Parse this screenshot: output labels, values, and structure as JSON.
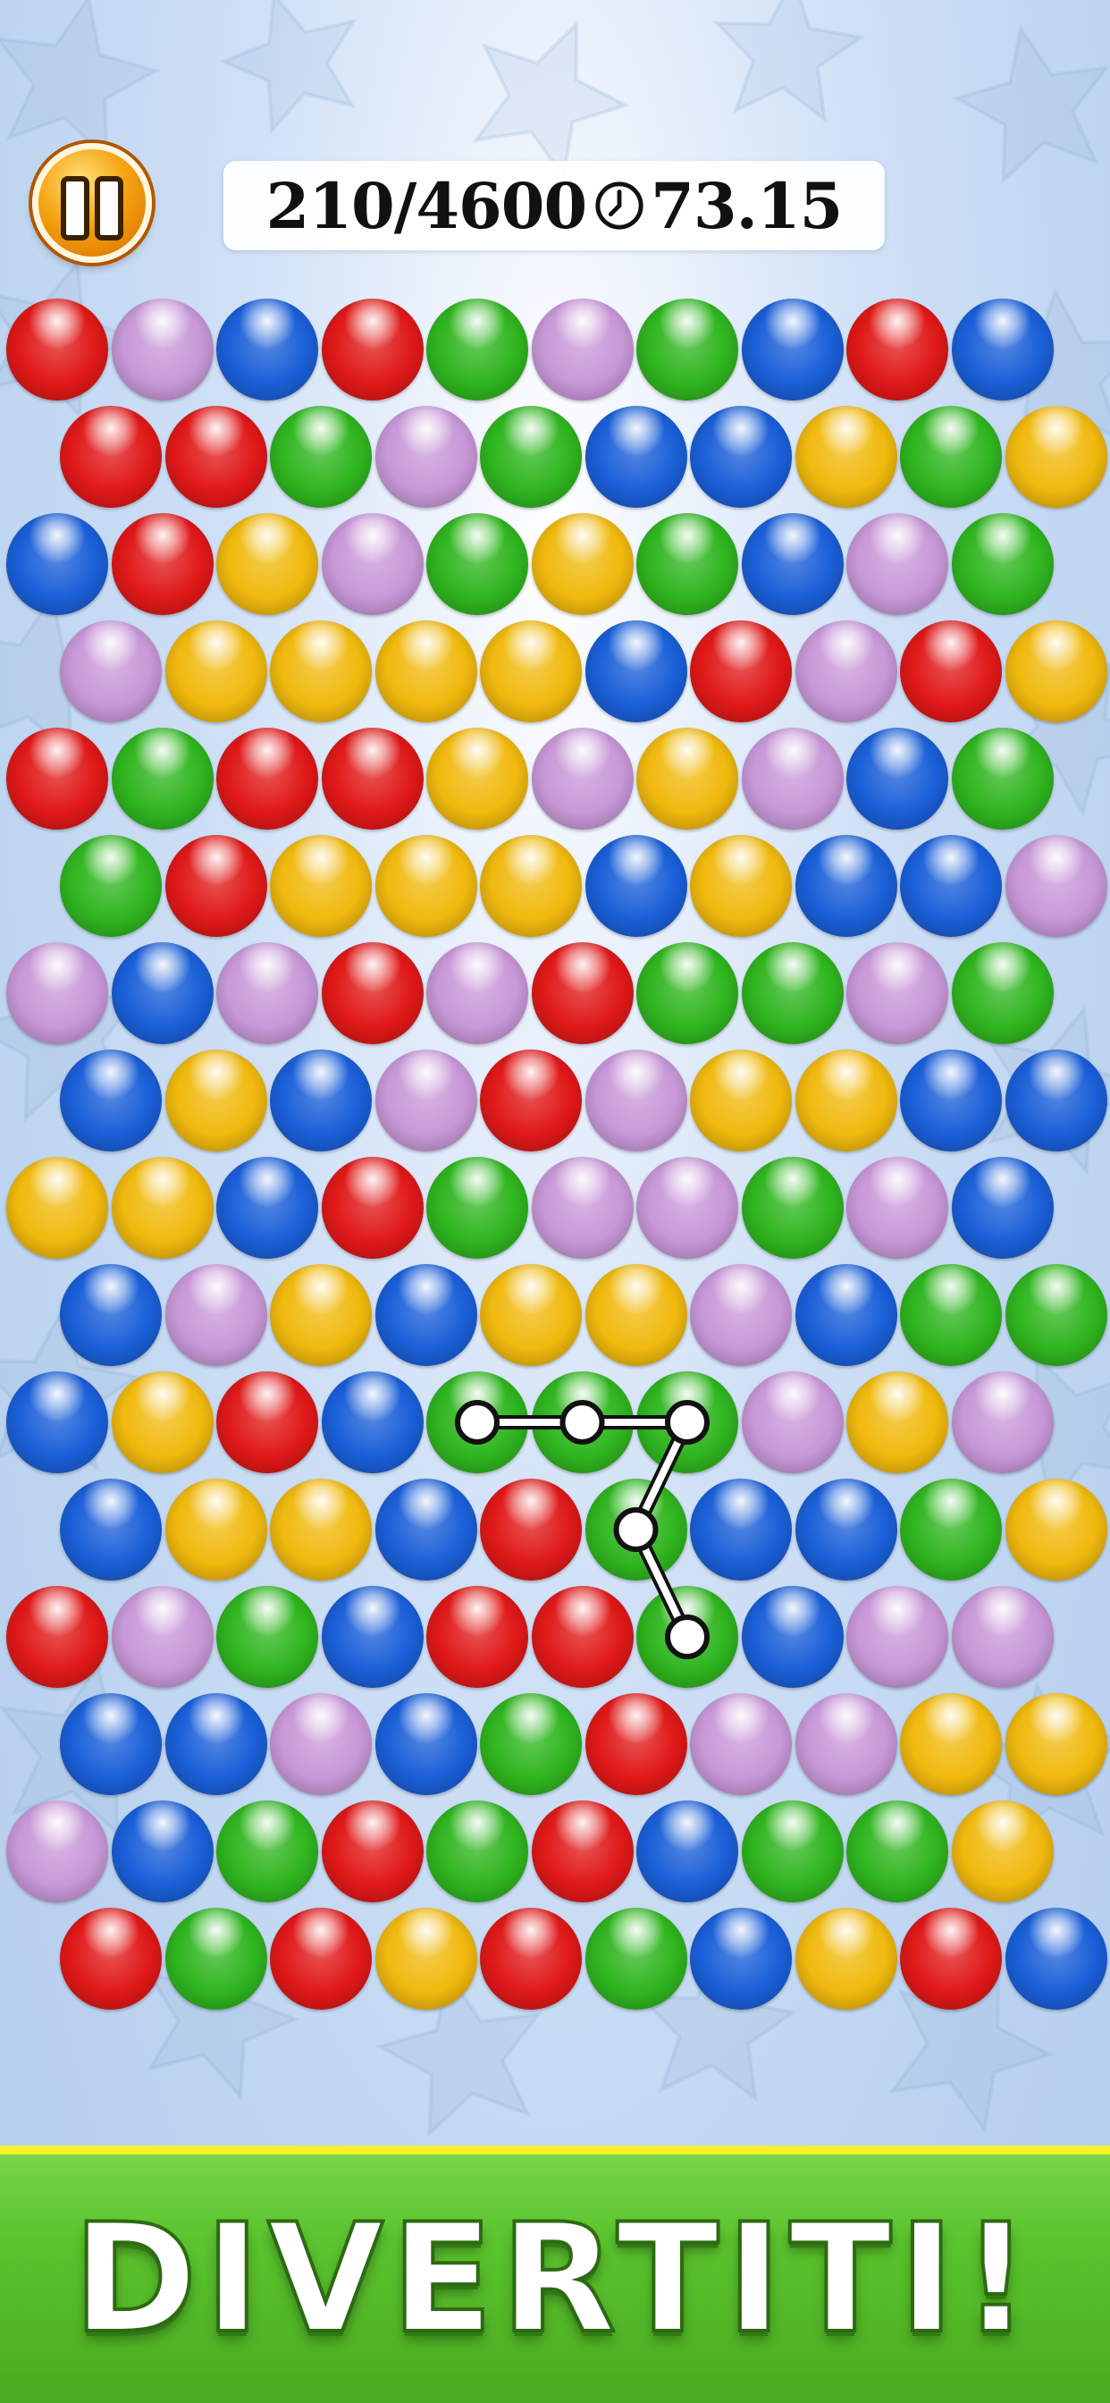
{
  "hud": {
    "score": "210/4600",
    "time": "73.15",
    "pause_icon": "pause-icon",
    "clock_icon": "clock-icon"
  },
  "board": {
    "rows": [
      [
        "red",
        "purple",
        "blue",
        "red",
        "green",
        "purple",
        "green",
        "blue",
        "red",
        "blue"
      ],
      [
        "red",
        "red",
        "green",
        "purple",
        "green",
        "blue",
        "blue",
        "yellow",
        "green",
        "yellow"
      ],
      [
        "blue",
        "red",
        "yellow",
        "purple",
        "green",
        "yellow",
        "green",
        "blue",
        "purple",
        "green"
      ],
      [
        "purple",
        "yellow",
        "yellow",
        "yellow",
        "yellow",
        "blue",
        "red",
        "purple",
        "red",
        "yellow"
      ],
      [
        "red",
        "green",
        "red",
        "red",
        "yellow",
        "purple",
        "yellow",
        "purple",
        "blue",
        "green"
      ],
      [
        "green",
        "red",
        "yellow",
        "yellow",
        "yellow",
        "blue",
        "yellow",
        "blue",
        "blue",
        "purple"
      ],
      [
        "purple",
        "blue",
        "purple",
        "red",
        "purple",
        "red",
        "green",
        "green",
        "purple",
        "green"
      ],
      [
        "blue",
        "yellow",
        "blue",
        "purple",
        "red",
        "purple",
        "yellow",
        "yellow",
        "blue",
        "blue"
      ],
      [
        "yellow",
        "yellow",
        "blue",
        "red",
        "green",
        "purple",
        "purple",
        "green",
        "purple",
        "blue"
      ],
      [
        "blue",
        "purple",
        "yellow",
        "blue",
        "yellow",
        "yellow",
        "purple",
        "blue",
        "green",
        "green"
      ],
      [
        "blue",
        "yellow",
        "red",
        "blue",
        "green",
        "green",
        "green",
        "purple",
        "yellow",
        "purple"
      ],
      [
        "blue",
        "yellow",
        "yellow",
        "blue",
        "red",
        "green",
        "blue",
        "blue",
        "green",
        "yellow"
      ],
      [
        "red",
        "purple",
        "green",
        "blue",
        "red",
        "red",
        "green",
        "blue",
        "purple",
        "purple"
      ],
      [
        "blue",
        "blue",
        "purple",
        "blue",
        "green",
        "red",
        "purple",
        "purple",
        "yellow",
        "yellow"
      ],
      [
        "purple",
        "blue",
        "green",
        "red",
        "green",
        "red",
        "blue",
        "green",
        "green",
        "yellow"
      ],
      [
        "red",
        "green",
        "red",
        "yellow",
        "red",
        "green",
        "blue",
        "yellow",
        "red",
        "blue"
      ]
    ],
    "selected_path": [
      [
        10,
        4
      ],
      [
        10,
        5
      ],
      [
        10,
        6
      ],
      [
        11,
        5
      ],
      [
        12,
        6
      ]
    ]
  },
  "colors": {
    "red": "#e01818",
    "purple": "#c898d8",
    "blue": "#1a5fd8",
    "green": "#2fb51f",
    "yellow": "#f0b90e"
  },
  "banner": {
    "text": "DIVERTITI!"
  }
}
